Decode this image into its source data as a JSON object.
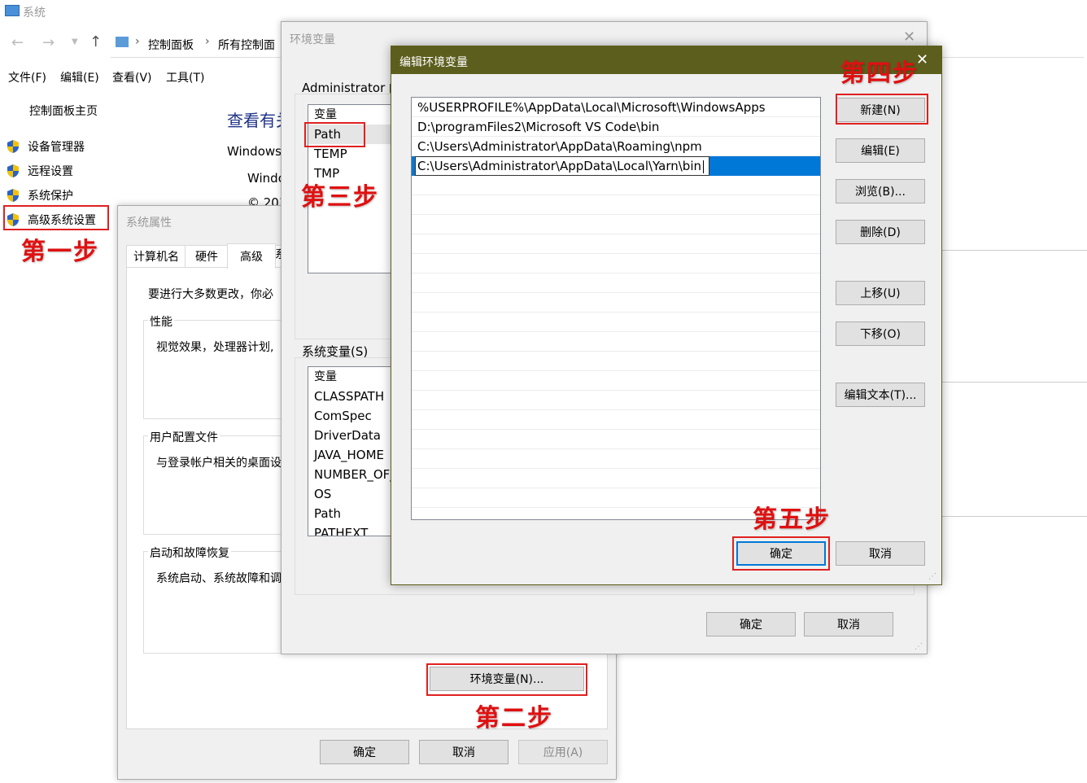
{
  "system_window": {
    "title": "系统",
    "breadcrumb": [
      "控制面板",
      "所有控制面"
    ],
    "menu": [
      "文件(F)",
      "编辑(E)",
      "查看(V)",
      "工具(T)"
    ],
    "sidebar_home": "控制面板主页",
    "sidebar_items": [
      "设备管理器",
      "远程设置",
      "系统保护",
      "高级系统设置"
    ],
    "main_heading": "查看有关",
    "windows_text_1": "Windows",
    "windows_text_2": "Windo",
    "copyright_text": "© 201"
  },
  "sys_props": {
    "title": "系统属性",
    "tabs": [
      "计算机名",
      "硬件",
      "高级",
      "系"
    ],
    "intro": "要进行大多数更改，你必",
    "perf_label": "性能",
    "perf_text": "视觉效果，处理器计划,",
    "profile_label": "用户配置文件",
    "profile_text": "与登录帐户相关的桌面设",
    "startup_label": "启动和故障恢复",
    "startup_text": "系统启动、系统故障和调",
    "env_button": "环境变量(N)...",
    "ok": "确定",
    "cancel": "取消",
    "apply": "应用(A)"
  },
  "env_vars": {
    "title": "环境变量",
    "user_label": "Administrator 的",
    "user_header": "变量",
    "user_items": [
      "Path",
      "TEMP",
      "TMP"
    ],
    "sys_label": "系统变量(S)",
    "sys_header": "变量",
    "sys_items": [
      "CLASSPATH",
      "ComSpec",
      "DriverData",
      "JAVA_HOME",
      "NUMBER_OF_",
      "OS",
      "Path",
      "PATHEXT"
    ],
    "ok": "确定",
    "cancel": "取消"
  },
  "edit_env": {
    "title": "编辑环境变量",
    "entries": [
      "%USERPROFILE%\\AppData\\Local\\Microsoft\\WindowsApps",
      "D:\\programFiles2\\Microsoft VS Code\\bin",
      "C:\\Users\\Administrator\\AppData\\Roaming\\npm",
      "C:\\Users\\Administrator\\AppData\\Local\\Yarn\\bin"
    ],
    "buttons": {
      "new": "新建(N)",
      "edit": "编辑(E)",
      "browse": "浏览(B)...",
      "delete": "删除(D)",
      "up": "上移(U)",
      "down": "下移(O)",
      "edit_text": "编辑文本(T)..."
    },
    "ok": "确定",
    "cancel": "取消"
  },
  "annotations": {
    "step1": "第一步",
    "step2": "第二步",
    "step3": "第三步",
    "step4": "第四步",
    "step5": "第五步"
  },
  "colors": {
    "edit_titlebar": "#5c5e1d",
    "annotation_red": "#e01010",
    "selection_blue": "#0078d7"
  }
}
